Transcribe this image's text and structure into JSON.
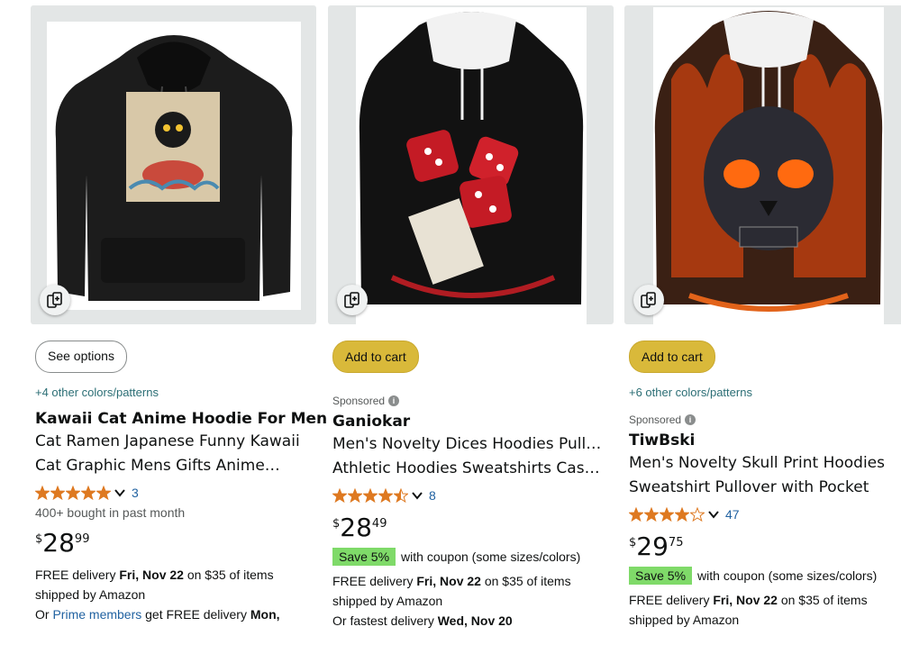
{
  "cards": [
    {
      "button_label": "See options",
      "colors_text": "+4 other colors/patterns",
      "title_line1": "Kawaii Cat Anime Hoodie For Men…",
      "title_line2": "Cat Ramen Japanese Funny Kawaii",
      "title_line3": "Cat Graphic Mens Gifts Anime…",
      "rating_stars": 5,
      "review_count": "3",
      "bought_text": "400+ bought in past month",
      "price_symbol": "$",
      "price_whole": "28",
      "price_fraction": "99",
      "delivery_prefix": "FREE delivery ",
      "delivery_date": "Fri, Nov 22",
      "delivery_suffix": " on $35 of items",
      "delivery_line2": "shipped by Amazon",
      "prime_prefix": "Or ",
      "prime_link": "Prime members",
      "prime_suffix": " get FREE delivery ",
      "prime_date": "Mon,",
      "image_icon": "hoodie-cat-ramen-image",
      "compare_icon": "compare-icon"
    },
    {
      "button_label": "Add to cart",
      "sponsored_label": "Sponsored",
      "brand": "Ganiokar",
      "title_line1": "Men's Novelty Dices Hoodies Pullover",
      "title_line2": "Athletic Hoodies Sweatshirts Casual…",
      "rating_stars": 4.5,
      "review_count": "8",
      "price_symbol": "$",
      "price_whole": "28",
      "price_fraction": "49",
      "coupon_badge": "Save 5%",
      "coupon_text": "with coupon (some sizes/colors)",
      "delivery_prefix": "FREE delivery ",
      "delivery_date": "Fri, Nov 22",
      "delivery_suffix": " on $35 of items",
      "delivery_line2": "shipped by Amazon",
      "fastest_prefix": "Or fastest delivery ",
      "fastest_date": "Wed, Nov 20",
      "image_icon": "hoodie-dice-image"
    },
    {
      "button_label": "Add to cart",
      "colors_text": "+6 other colors/patterns",
      "sponsored_label": "Sponsored",
      "brand": "TiwBski",
      "title_line1": "Men's Novelty Skull Print Hoodies",
      "title_line2": "Sweatshirt Pullover with Pocket",
      "rating_stars": 4,
      "review_count": "47",
      "price_symbol": "$",
      "price_whole": "29",
      "price_fraction": "75",
      "coupon_badge": "Save 5%",
      "coupon_text": "with coupon (some sizes/colors)",
      "delivery_prefix": "FREE delivery ",
      "delivery_date": "Fri, Nov 22",
      "delivery_suffix": " on $35 of items",
      "delivery_line2": "shipped by Amazon",
      "image_icon": "hoodie-flaming-skull-image"
    }
  ],
  "colors": {
    "star": "#de7921",
    "button_yellow": "#d9b93a",
    "link": "#2162a1",
    "coupon_green": "#7fda69"
  }
}
